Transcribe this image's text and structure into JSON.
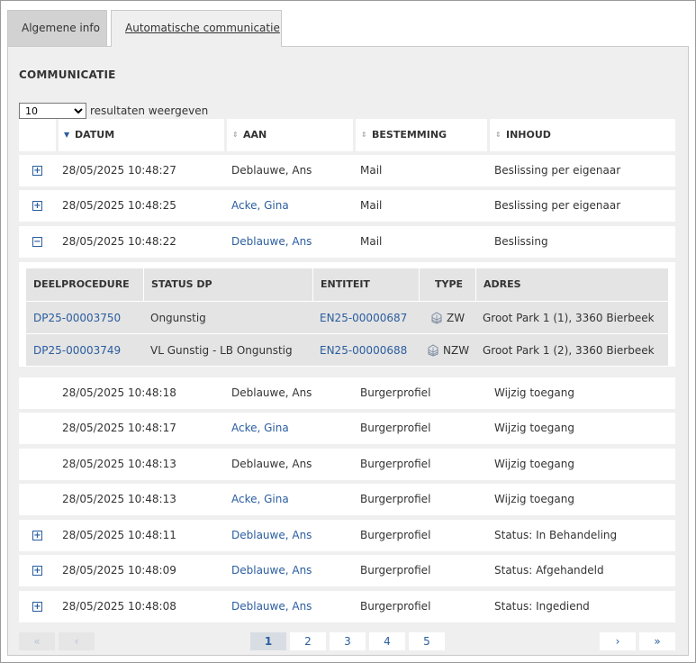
{
  "tabs": {
    "general": "Algemene info",
    "automatic": "Automatische communicatie"
  },
  "section_title": "COMMUNICATIE",
  "page_size": {
    "value": "10",
    "label": "resultaten weergeven"
  },
  "columns": {
    "datum": "DATUM",
    "aan": "AAN",
    "bestemming": "BESTEMMING",
    "inhoud": "INHOUD"
  },
  "rows": [
    {
      "expander": "+",
      "datum": "28/05/2025 10:48:27",
      "aan": "Deblauwe, Ans",
      "bestemming": "Mail",
      "inhoud": "Beslissing per eigenaar"
    },
    {
      "expander": "+",
      "datum": "28/05/2025 10:48:25",
      "aan": "Acke, Gina",
      "bestemming": "Mail",
      "inhoud": "Beslissing per eigenaar"
    },
    {
      "expander": "−",
      "datum": "28/05/2025 10:48:22",
      "aan": "Deblauwe, Ans",
      "bestemming": "Mail",
      "inhoud": "Beslissing"
    },
    {
      "expander": "",
      "datum": "28/05/2025 10:48:18",
      "aan": "Deblauwe, Ans",
      "bestemming": "Burgerprofiel",
      "inhoud": "Wijzig toegang"
    },
    {
      "expander": "",
      "datum": "28/05/2025 10:48:17",
      "aan": "Acke, Gina",
      "bestemming": "Burgerprofiel",
      "inhoud": "Wijzig toegang"
    },
    {
      "expander": "",
      "datum": "28/05/2025 10:48:13",
      "aan": "Deblauwe, Ans",
      "bestemming": "Burgerprofiel",
      "inhoud": "Wijzig toegang"
    },
    {
      "expander": "",
      "datum": "28/05/2025 10:48:13",
      "aan": "Acke, Gina",
      "bestemming": "Burgerprofiel",
      "inhoud": "Wijzig toegang"
    },
    {
      "expander": "+",
      "datum": "28/05/2025 10:48:11",
      "aan": "Deblauwe, Ans",
      "bestemming": "Burgerprofiel",
      "inhoud": "Status: In Behandeling"
    },
    {
      "expander": "+",
      "datum": "28/05/2025 10:48:09",
      "aan": "Deblauwe, Ans",
      "bestemming": "Burgerprofiel",
      "inhoud": "Status: Afgehandeld"
    },
    {
      "expander": "+",
      "datum": "28/05/2025 10:48:08",
      "aan": "Deblauwe, Ans",
      "bestemming": "Burgerprofiel",
      "inhoud": "Status: Ingediend"
    }
  ],
  "detail": {
    "columns": {
      "deelprocedure": "DEELPROCEDURE",
      "status": "STATUS DP",
      "entiteit": "ENTITEIT",
      "type": "TYPE",
      "adres": "ADRES"
    },
    "rows": [
      {
        "deelprocedure": "DP25-00003750",
        "status": "Ongunstig",
        "entiteit": "EN25-00000687",
        "type": "ZW",
        "adres": "Groot Park 1 (1), 3360 Bierbeek"
      },
      {
        "deelprocedure": "DP25-00003749",
        "status": "VL Gunstig - LB Ongunstig",
        "entiteit": "EN25-00000688",
        "type": "NZW",
        "adres": "Groot Park 1 (2), 3360 Bierbeek"
      }
    ]
  },
  "pagination": {
    "first": "«",
    "prev": "‹",
    "pages": [
      "1",
      "2",
      "3",
      "4",
      "5"
    ],
    "current": "1",
    "next": "›",
    "last": "»"
  },
  "colors": {
    "link": "#2a5d9f",
    "panel": "#efefef"
  }
}
